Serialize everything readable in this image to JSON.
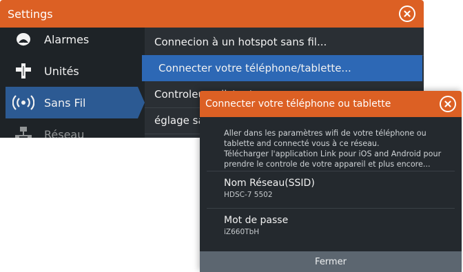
{
  "settings": {
    "title": "Settings",
    "close_icon": "close-circle-icon",
    "sidebar": [
      {
        "label": "Alarmes",
        "icon": "alarm-bell-icon"
      },
      {
        "label": "Unités",
        "icon": "units-ruler-icon"
      },
      {
        "label": "Sans Fil",
        "icon": "wireless-icon"
      },
      {
        "label": "Réseau",
        "icon": "network-icon"
      }
    ],
    "items": [
      {
        "label": "Connecion à un hotspot sans fil..."
      },
      {
        "label": "Connecter votre téléphone/tablette..."
      },
      {
        "label": "Controleurs distants"
      },
      {
        "label": "églage sans fil"
      }
    ]
  },
  "dialog": {
    "title": "Connecter votre téléphone ou tablette",
    "close_icon": "close-circle-icon",
    "description_lines": [
      "Aller dans les paramètres wifi de votre téléphone ou",
      "tablette and connecté vous à ce réseau.",
      "Télécharger l'application Link pour iOS and Android pour",
      "prendre le controle de votre appareil et plus encore..."
    ],
    "network_label": "Nom Réseau(SSID)",
    "network_value": "HDSC-7 5502",
    "password_label": "Mot de passe",
    "password_value": "iZ660TbH",
    "close_button": "Fermer"
  },
  "colors": {
    "title_orange": "#dc6024",
    "panel_dark": "#1e2327",
    "selected_blue": "#2d68b5",
    "footer_gray": "#5c6670"
  }
}
